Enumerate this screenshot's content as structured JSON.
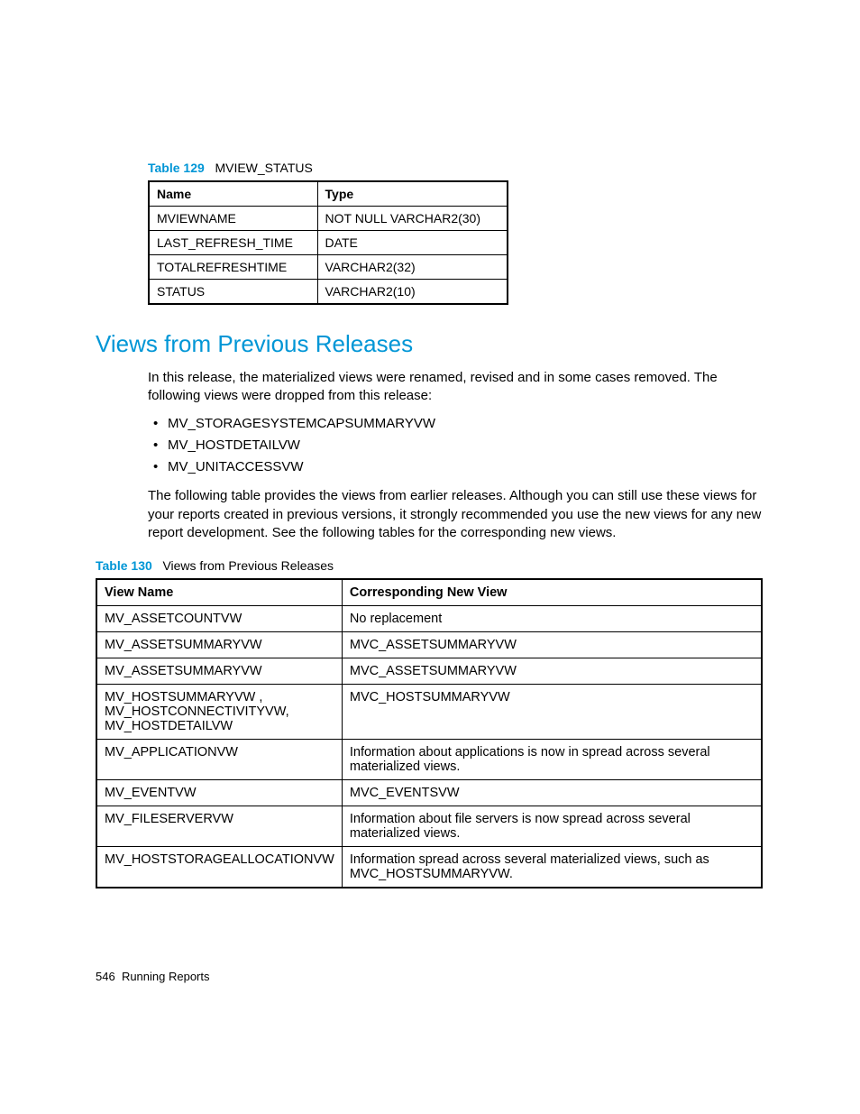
{
  "table129": {
    "label": "Table 129",
    "title": "MVIEW_STATUS",
    "headers": {
      "name": "Name",
      "type": "Type"
    },
    "rows": [
      {
        "name": "MVIEWNAME",
        "type": "NOT NULL VARCHAR2(30)"
      },
      {
        "name": "LAST_REFRESH_TIME",
        "type": "DATE"
      },
      {
        "name": "TOTALREFRESHTIME",
        "type": " VARCHAR2(32)"
      },
      {
        "name": "STATUS",
        "type": "VARCHAR2(10)"
      }
    ]
  },
  "section": {
    "heading": "Views from Previous Releases",
    "intro": "In this release, the materialized views were renamed, revised and in some cases removed. The following views were dropped from this release:",
    "dropped": [
      "MV_STORAGESYSTEMCAPSUMMARYVW",
      "MV_HOSTDETAILVW",
      "MV_UNITACCESSVW"
    ],
    "para2": "The following table provides the views from earlier releases. Although you can still use these views for your reports created in previous versions, it strongly recommended you use the new views for any new report development. See the following tables for the corresponding new views."
  },
  "table130": {
    "label": "Table 130",
    "title": "Views from Previous Releases",
    "headers": {
      "view": "View Name",
      "new": "Corresponding New View"
    },
    "rows": [
      {
        "view": "MV_ASSETCOUNTVW",
        "new": "No replacement"
      },
      {
        "view": "MV_ASSETSUMMARYVW",
        "new": "MVC_ASSETSUMMARYVW"
      },
      {
        "view": "MV_ASSETSUMMARYVW",
        "new": "MVC_ASSETSUMMARYVW"
      },
      {
        "view": "MV_HOSTSUMMARYVW , MV_HOSTCONNECTIVITYVW, MV_HOSTDETAILVW",
        "new": "MVC_HOSTSUMMARYVW"
      },
      {
        "view": "MV_APPLICATIONVW",
        "new": "Information about applications is now in spread across several materialized views."
      },
      {
        "view": "MV_EVENTVW",
        "new": "MVC_EVENTSVW"
      },
      {
        "view": "MV_FILESERVERVW",
        "new": "Information about file servers is now spread across several materialized views."
      },
      {
        "view": "MV_HOSTSTORAGEALLOCATIONVW",
        "new": "Information spread across several materialized views, such as MVC_HOSTSUMMARYVW."
      }
    ]
  },
  "footer": {
    "page": "546",
    "section": "Running Reports"
  }
}
